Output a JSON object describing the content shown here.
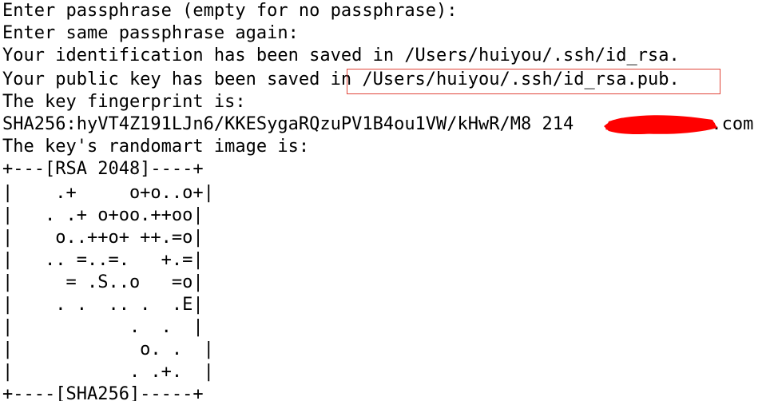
{
  "terminal": {
    "lines": [
      "Enter passphrase (empty for no passphrase):",
      "Enter same passphrase again:",
      "Your identification has been saved in /Users/huiyou/.ssh/id_rsa.",
      "Your public key has been saved in /Users/huiyou/.ssh/id_rsa.pub.",
      "The key fingerprint is:",
      "SHA256:hyVT4Z191LJn6/KKESygaRQzuPV1B4ou1VW/kHwR/M8 214             .com",
      "The key's randomart image is:",
      "+---[RSA 2048]----+",
      "|    .+     o+o..o+|",
      "|   . .+ o+oo.++oo|",
      "|    o..++o+ ++.=o|",
      "|   .. =..=.   +.=|",
      "|     = .S..o   =o|",
      "|    . .  .. .  .E|",
      "|           .  .  |",
      "|            o. .  |",
      "|           . .+.  |",
      "+----[SHA256]-----+"
    ]
  },
  "annotation": {
    "highlight_color": "#e0463a",
    "redaction_color": "#ff0000"
  }
}
